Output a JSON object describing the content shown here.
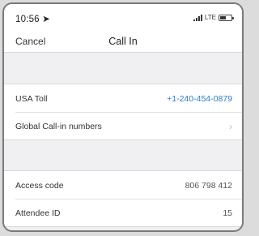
{
  "status": {
    "time": "10:56 ➤",
    "network": "LTE"
  },
  "nav": {
    "cancel": "Cancel",
    "title": "Call In"
  },
  "dial": {
    "usa_label": "USA Toll",
    "usa_number": "+1-240-454-0879",
    "global_label": "Global Call-in numbers"
  },
  "meeting": {
    "access_label": "Access code",
    "access_value": "806 798 412",
    "attendee_label": "Attendee ID",
    "attendee_value": "15"
  },
  "colors": {
    "link": "#2b7bd1",
    "background": "#f0f0f2"
  }
}
